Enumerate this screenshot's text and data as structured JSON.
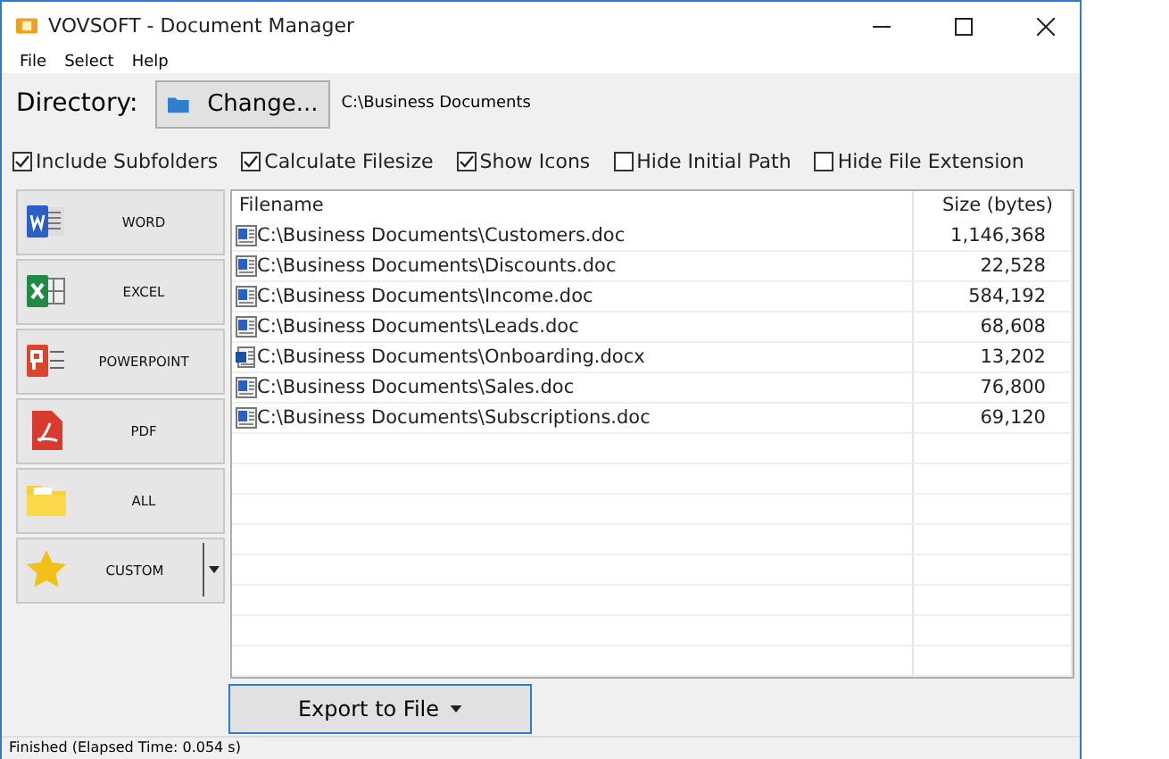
{
  "window": {
    "title": "VOVSOFT - Document Manager"
  },
  "menu": [
    "File",
    "Select",
    "Help"
  ],
  "directory": {
    "label": "Directory:",
    "button": "Change...",
    "path": "C:\\Business Documents"
  },
  "options": [
    {
      "label": "Include Subfolders",
      "checked": true
    },
    {
      "label": "Calculate Filesize",
      "checked": true
    },
    {
      "label": "Show Icons",
      "checked": true
    },
    {
      "label": "Hide Initial Path",
      "checked": false
    },
    {
      "label": "Hide File Extension",
      "checked": false
    }
  ],
  "file_types": [
    {
      "kind": "word",
      "label": "WORD"
    },
    {
      "kind": "excel",
      "label": "EXCEL"
    },
    {
      "kind": "powerpoint",
      "label": "POWERPOINT"
    },
    {
      "kind": "pdf",
      "label": "PDF"
    },
    {
      "kind": "all",
      "label": "ALL"
    },
    {
      "kind": "custom",
      "label": "CUSTOM"
    }
  ],
  "table": {
    "columns": [
      "Filename",
      "Size (bytes)"
    ],
    "rows": [
      {
        "kind": "doc",
        "filename": "C:\\Business Documents\\Customers.doc",
        "size": "1,146,368"
      },
      {
        "kind": "doc",
        "filename": "C:\\Business Documents\\Discounts.doc",
        "size": "22,528"
      },
      {
        "kind": "doc",
        "filename": "C:\\Business Documents\\Income.doc",
        "size": "584,192"
      },
      {
        "kind": "doc",
        "filename": "C:\\Business Documents\\Leads.doc",
        "size": "68,608"
      },
      {
        "kind": "docx",
        "filename": "C:\\Business Documents\\Onboarding.docx",
        "size": "13,202"
      },
      {
        "kind": "doc",
        "filename": "C:\\Business Documents\\Sales.doc",
        "size": "76,800"
      },
      {
        "kind": "doc",
        "filename": "C:\\Business Documents\\Subscriptions.doc",
        "size": "69,120"
      }
    ]
  },
  "export_button": "Export to File",
  "status_bar": "Finished (Elapsed Time: 0.054 s)"
}
